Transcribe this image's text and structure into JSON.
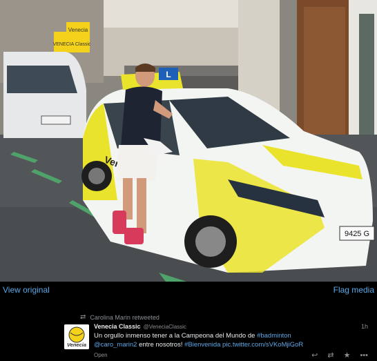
{
  "media": {
    "view_original_label": "View original",
    "flag_media_label": "Flag media",
    "plate_text": "9425 G",
    "car_lettering": "Venecia",
    "sign_top": "Venecia",
    "sign_bottom": "VENECIA Classic"
  },
  "retweet": {
    "context_label": "Carolina Marin retweeted"
  },
  "tweet": {
    "display_name": "Venecia Classic",
    "handle": "@VeneciaClassic",
    "time": "1h",
    "text_line1_pre": "Un orgullo inmenso tener a la Campeona del Mundo de ",
    "hashtag_badminton": "#badminton",
    "mention": "@caro_marin2",
    "text_line2_mid": " entre nosotros! ",
    "hashtag_bienvenida": "#Bienvenida",
    "link": " pic.twitter.com/sVKoMjiGoR",
    "open_label": "Open",
    "avatar_text": "Venecia"
  },
  "icons": {
    "retweet_context": "retweet-icon",
    "reply": "reply-icon",
    "retweet": "retweet-icon",
    "favorite": "star-icon",
    "more": "more-icon"
  }
}
